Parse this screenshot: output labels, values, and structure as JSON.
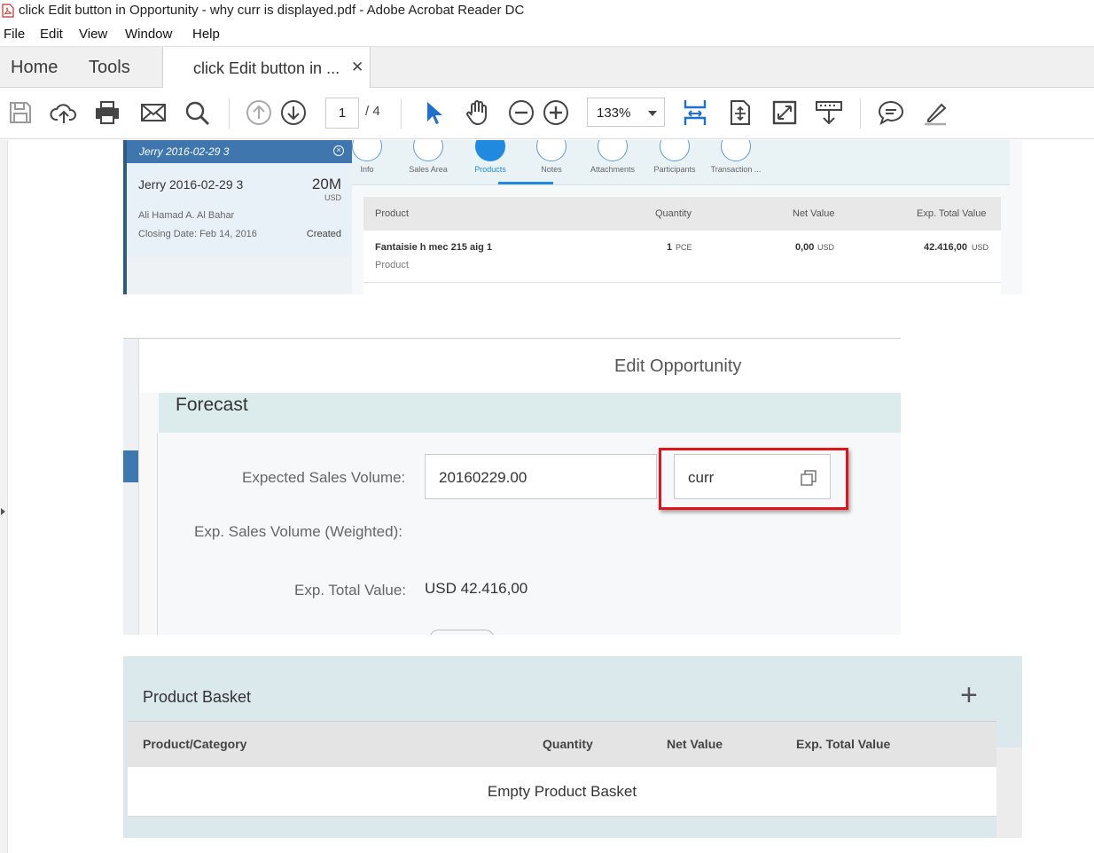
{
  "window": {
    "title": "click Edit button in Opportunity - why curr is displayed.pdf - Adobe Acrobat Reader DC"
  },
  "menu": [
    "File",
    "Edit",
    "View",
    "Window",
    "Help"
  ],
  "tabs": {
    "home": "Home",
    "tools": "Tools",
    "document": "click Edit button in ...",
    "close_glyph": "✕"
  },
  "toolbar": {
    "page_current": "1",
    "page_total": "/  4",
    "zoom": "133%",
    "icons": [
      "save-icon",
      "cloud-upload-icon",
      "print-icon",
      "email-icon",
      "search-icon",
      "previous-page-icon",
      "next-page-icon",
      "select-cursor-icon",
      "hand-tool-icon",
      "zoom-out-icon",
      "zoom-in-icon",
      "fit-page-icon",
      "scroll-mode-icon",
      "full-screen-icon",
      "read-mode-icon",
      "comment-icon",
      "highlight-icon"
    ]
  },
  "shot1": {
    "card": {
      "header": "Jerry 2016-02-29 3",
      "name": "Jerry 2016-02-29 3",
      "amount": "20M",
      "currency": "USD",
      "account": "Ali Hamad A. Al Bahar",
      "closing": "Closing Date: Feb 14, 2016",
      "status": "Created"
    },
    "tabs": [
      {
        "label": "Info"
      },
      {
        "label": "Sales Area"
      },
      {
        "label": "Products"
      },
      {
        "label": "Notes"
      },
      {
        "label": "Attachments"
      },
      {
        "label": "Participants"
      },
      {
        "label": "Transaction ..."
      }
    ],
    "table": {
      "headers": [
        "Product",
        "Quantity",
        "Net Value",
        "Exp. Total Value"
      ],
      "row": {
        "product": "Fantaisie h mec 215 aig 1",
        "product_sub": "Product",
        "quantity": "1",
        "quantity_unit": "PCE",
        "net": "0,00",
        "net_unit": "USD",
        "total": "42.416,00",
        "total_unit": "USD"
      }
    }
  },
  "shot2": {
    "title": "Edit Opportunity",
    "section": "Forecast",
    "labels": {
      "expected": "Expected Sales Volume:",
      "weighted": "Exp. Sales Volume (Weighted):",
      "total": "Exp. Total Value:"
    },
    "expected_value": "20160229.00",
    "currency_value": "curr",
    "total_value": "USD 42.416,00"
  },
  "shot3": {
    "title": "Product Basket",
    "add_glyph": "+",
    "headers": [
      "Product/Category",
      "Quantity",
      "Net Value",
      "Exp. Total Value"
    ],
    "empty": "Empty Product Basket"
  },
  "colors": {
    "highlight_box": "#e0141a",
    "accent_blue": "#1f8ae0",
    "header_blue": "#3e76ad"
  }
}
